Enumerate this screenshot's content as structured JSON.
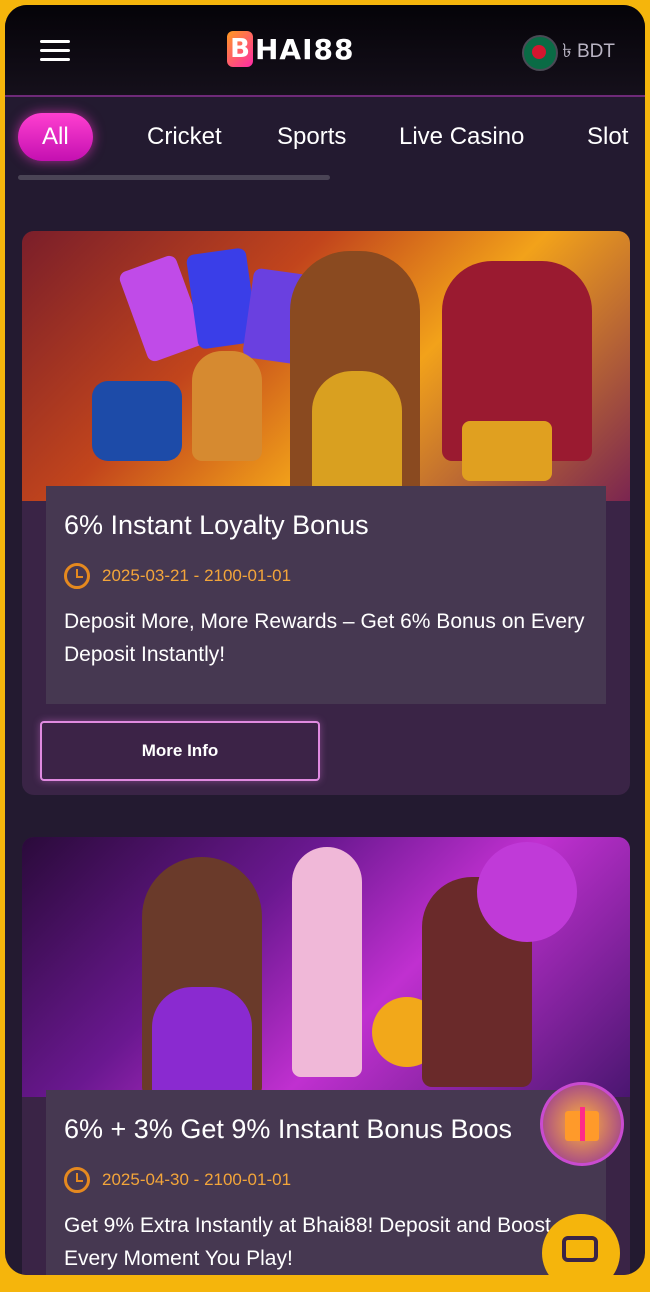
{
  "header": {
    "logo_mark": "B",
    "logo_text": "HAI88",
    "currency": "৳ BDT"
  },
  "tabs": [
    {
      "label": "All",
      "active": true
    },
    {
      "label": "Cricket"
    },
    {
      "label": "Sports"
    },
    {
      "label": "Live Casino"
    },
    {
      "label": "Slot"
    }
  ],
  "promotions": [
    {
      "title": "6% Instant Loyalty Bonus",
      "dates": "2025-03-21 - 2100-01-01",
      "description": "Deposit More, More Rewards – Get 6% Bonus on Every Deposit Instantly!",
      "button": "More Info"
    },
    {
      "title": "6% + 3% Get 9% Instant Bonus Boos",
      "dates": "2025-04-30 - 2100-01-01",
      "description": "Get 9% Extra Instantly at Bhai88! Deposit and Boost Every Moment You Play!"
    }
  ],
  "icons": {
    "menu": "hamburger-icon",
    "clock": "clock-icon",
    "gift": "gift-icon",
    "chat": "chat-icon"
  },
  "colors": {
    "accent": "#e22fc6",
    "background": "#231a30",
    "date": "#f3a53a",
    "frame": "#f5b50c"
  }
}
